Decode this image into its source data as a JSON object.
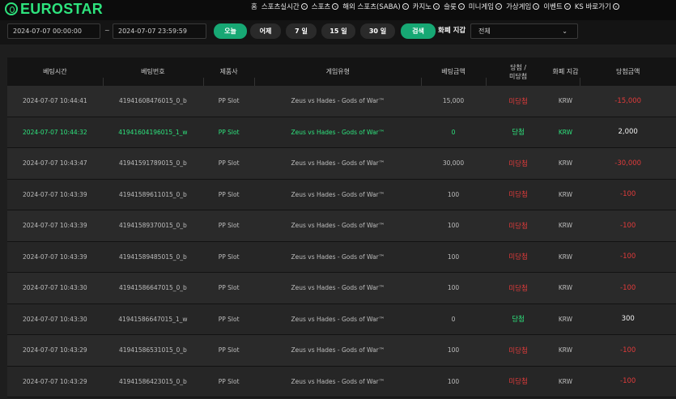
{
  "brand": {
    "logo_text": "EUROSTAR",
    "accent": "#2ee37d"
  },
  "nav": {
    "items": [
      {
        "label": "홈",
        "has_chevron": false
      },
      {
        "label": "스포츠실시간",
        "has_chevron": true
      },
      {
        "label": "스포츠",
        "has_chevron": true
      },
      {
        "label": "해외 스포츠(SABA)",
        "has_chevron": true
      },
      {
        "label": "카지노",
        "has_chevron": true
      },
      {
        "label": "슬롯",
        "has_chevron": true
      },
      {
        "label": "미니게임",
        "has_chevron": true
      },
      {
        "label": "가상게임",
        "has_chevron": true
      },
      {
        "label": "이벤트",
        "has_chevron": true
      },
      {
        "label": "KS 바로가기",
        "has_chevron": true
      }
    ]
  },
  "filter": {
    "start_date": "2024-07-07 00:00:00",
    "dash": "~",
    "end_date": "2024-07-07 23:59:59",
    "buttons": {
      "today": "오늘",
      "yesterday": "어제",
      "d7": "7 일",
      "d15": "15 일",
      "d30": "30 일",
      "search": "검색"
    },
    "wallet_label": "화폐 지갑",
    "wallet_value": "전체",
    "wallet_caret": "⌄"
  },
  "table": {
    "headers": {
      "bet_time": "베팅시간",
      "bet_no": "베팅번호",
      "provider": "제품사",
      "game_type": "게임유형",
      "bet_amount": "베팅금액",
      "result_line1": "당첨 /",
      "result_line2": "미당첨",
      "wallet": "화폐 지갑",
      "win_amount": "당첨금액"
    },
    "rows": [
      {
        "time": "2024-07-07 10:44:41",
        "no": "41941608476015_0_b",
        "provider": "PP Slot",
        "game": "Zeus vs Hades - Gods of War™",
        "bet": "15,000",
        "result": "미당첨",
        "wallet": "KRW",
        "win": "-15,000",
        "status": "lose"
      },
      {
        "time": "2024-07-07 10:44:32",
        "no": "41941604196015_1_w",
        "provider": "PP Slot",
        "game": "Zeus vs Hades - Gods of War™",
        "bet": "0",
        "result": "당첨",
        "wallet": "KRW",
        "win": "2,000",
        "status": "win"
      },
      {
        "time": "2024-07-07 10:43:47",
        "no": "41941591789015_0_b",
        "provider": "PP Slot",
        "game": "Zeus vs Hades - Gods of War™",
        "bet": "30,000",
        "result": "미당첨",
        "wallet": "KRW",
        "win": "-30,000",
        "status": "lose"
      },
      {
        "time": "2024-07-07 10:43:39",
        "no": "41941589611015_0_b",
        "provider": "PP Slot",
        "game": "Zeus vs Hades - Gods of War™",
        "bet": "100",
        "result": "미당첨",
        "wallet": "KRW",
        "win": "-100",
        "status": "lose"
      },
      {
        "time": "2024-07-07 10:43:39",
        "no": "41941589370015_0_b",
        "provider": "PP Slot",
        "game": "Zeus vs Hades - Gods of War™",
        "bet": "100",
        "result": "미당첨",
        "wallet": "KRW",
        "win": "-100",
        "status": "lose"
      },
      {
        "time": "2024-07-07 10:43:39",
        "no": "41941589485015_0_b",
        "provider": "PP Slot",
        "game": "Zeus vs Hades - Gods of War™",
        "bet": "100",
        "result": "미당첨",
        "wallet": "KRW",
        "win": "-100",
        "status": "lose"
      },
      {
        "time": "2024-07-07 10:43:30",
        "no": "41941586647015_0_b",
        "provider": "PP Slot",
        "game": "Zeus vs Hades - Gods of War™",
        "bet": "100",
        "result": "미당첨",
        "wallet": "KRW",
        "win": "-100",
        "status": "lose"
      },
      {
        "time": "2024-07-07 10:43:30",
        "no": "41941586647015_1_w",
        "provider": "PP Slot",
        "game": "Zeus vs Hades - Gods of War™",
        "bet": "0",
        "result": "당첨",
        "wallet": "KRW",
        "win": "300",
        "status": "win-row-plain"
      },
      {
        "time": "2024-07-07 10:43:29",
        "no": "41941586531015_0_b",
        "provider": "PP Slot",
        "game": "Zeus vs Hades - Gods of War™",
        "bet": "100",
        "result": "미당첨",
        "wallet": "KRW",
        "win": "-100",
        "status": "lose"
      },
      {
        "time": "2024-07-07 10:43:29",
        "no": "41941586423015_0_b",
        "provider": "PP Slot",
        "game": "Zeus vs Hades - Gods of War™",
        "bet": "100",
        "result": "미당첨",
        "wallet": "KRW",
        "win": "-100",
        "status": "lose"
      }
    ]
  },
  "colors": {
    "win": "#2ee37d",
    "lose": "#e03b3b",
    "primary_button": "#17a874"
  }
}
